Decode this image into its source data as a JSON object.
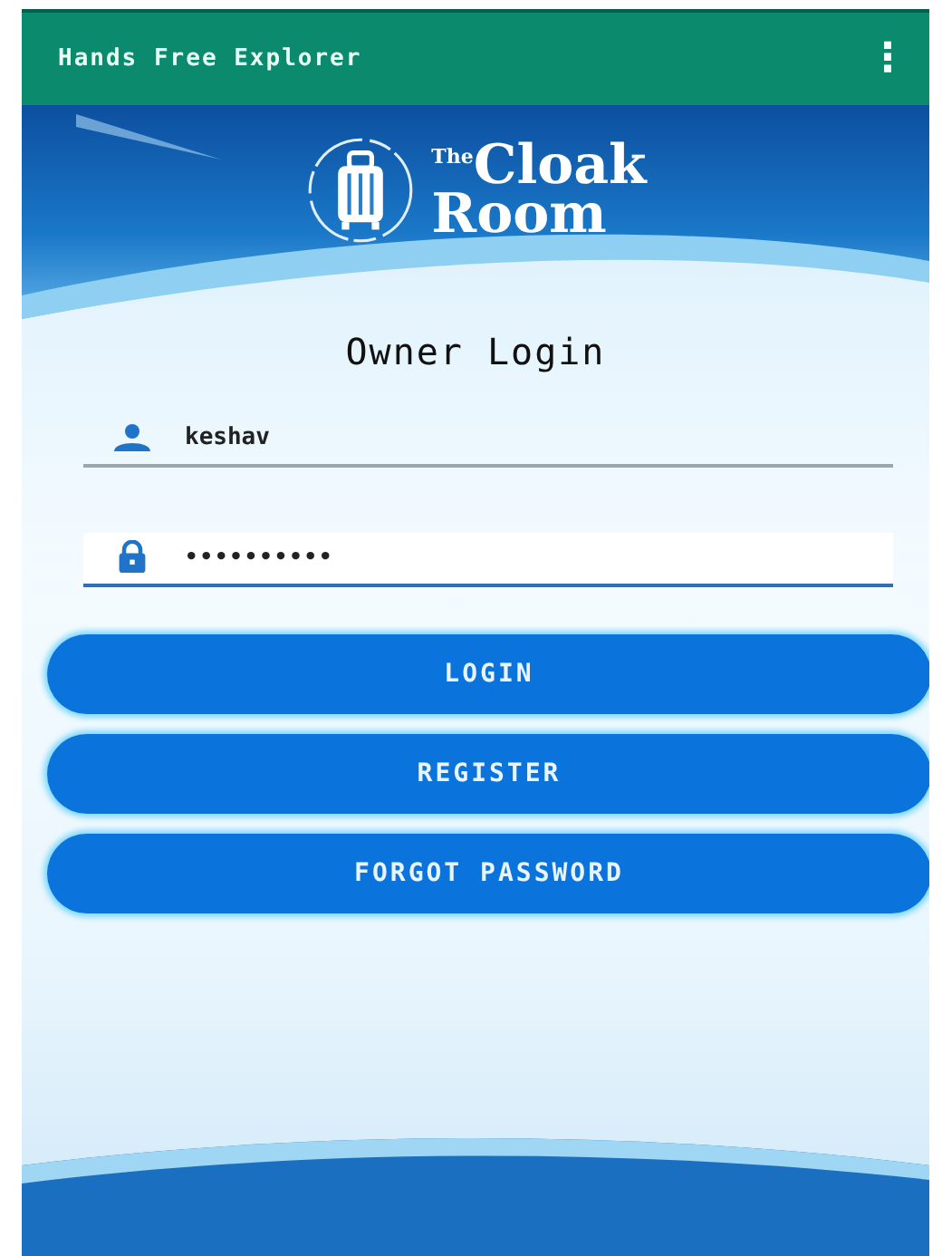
{
  "app_bar": {
    "title": "Hands Free Explorer",
    "menu": "⋮"
  },
  "logo": {
    "small": "The",
    "line_1": "Cloak",
    "line_2": "Room"
  },
  "heading": "Owner Login",
  "fields": [
    {
      "kind": "username",
      "value": "keshav",
      "focused": false
    },
    {
      "kind": "password",
      "value": "••••••••••",
      "focused": true
    }
  ],
  "buttons": [
    "LOGIN",
    "REGISTER",
    "FORGOT PASSWORD"
  ]
}
